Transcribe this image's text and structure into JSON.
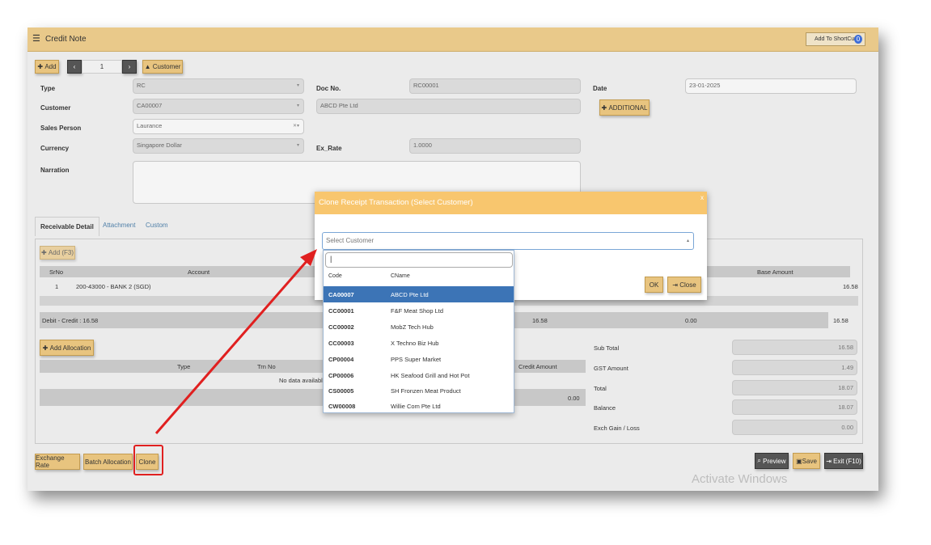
{
  "window": {
    "title": "Credit Note",
    "shortcut": "Add To ShortCut",
    "shortcut_badge": "0"
  },
  "toolbar": {
    "add": "Add",
    "record": "1",
    "customer": "Customer"
  },
  "form": {
    "type_label": "Type",
    "type_value": "RC",
    "docno_label": "Doc No.",
    "docno_value": "RC00001",
    "date_label": "Date",
    "date_value": "23-01-2025",
    "customer_label": "Customer",
    "customer_value": "CA00007",
    "customer_name": "ABCD Pte Ltd",
    "additional": "ADDITIONAL",
    "salesperson_label": "Sales Person",
    "salesperson_value": "Laurance",
    "currency_label": "Currency",
    "currency_value": "Singapore Dollar",
    "exrate_label": "Ex_Rate",
    "exrate_value": "1.0000",
    "narration_label": "Narration"
  },
  "tabs": [
    "Receivable Detail",
    "Attachment",
    "Custom"
  ],
  "detail": {
    "add": "Add (F3)",
    "headers": [
      "SrNo",
      "Account",
      "Base Amount"
    ],
    "row": {
      "srno": "1",
      "account": "200-43000 - BANK 2 (SGD)",
      "base": "16.58"
    },
    "footer_label": "Debit - Credit : 16.58",
    "footer_vals": [
      "16.58",
      "0.00",
      "16.58"
    ]
  },
  "allocation": {
    "add": "Add Allocation",
    "headers": [
      "Type",
      "Trn No",
      "Credit Amount"
    ],
    "empty": "No data available",
    "total": "0.00"
  },
  "summary": [
    {
      "label": "Sub Total",
      "value": "16.58"
    },
    {
      "label": "GST Amount",
      "value": "1.49"
    },
    {
      "label": "Total",
      "value": "18.07"
    },
    {
      "label": "Balance",
      "value": "18.07"
    },
    {
      "label": "Exch Gain / Loss",
      "value": "0.00"
    }
  ],
  "bottom": {
    "exchange": "Exchange Rate",
    "batch": "Batch Allocation",
    "clone": "Clone",
    "preview": "Preview",
    "save": "Save",
    "exit": "Exit (F10)"
  },
  "modal": {
    "title": "Clone Receipt Transaction (Select Customer)",
    "close": "x",
    "placeholder": "Select Customer",
    "ok": "OK",
    "cancel": "Close"
  },
  "dropdown": {
    "headers": {
      "code": "Code",
      "name": "CName"
    },
    "items": [
      {
        "code": "CA00007",
        "name": "ABCD Pte Ltd"
      },
      {
        "code": "CC00001",
        "name": "F&F Meat Shop Ltd"
      },
      {
        "code": "CC00002",
        "name": "MobZ Tech Hub"
      },
      {
        "code": "CC00003",
        "name": "X Techno Biz Hub"
      },
      {
        "code": "CP00004",
        "name": "PPS Super Market"
      },
      {
        "code": "CP00006",
        "name": "HK Seafood Grill and Hot Pot"
      },
      {
        "code": "CS00005",
        "name": "SH Fronzen Meat Product"
      },
      {
        "code": "CW00008",
        "name": "Willie Com Pte Ltd"
      }
    ]
  },
  "watermark": "Activate Windows",
  "colors": {
    "accent": "#e8c47f",
    "header": "#f8c66e",
    "selected": "#3c74b6",
    "annotation": "#e02020"
  }
}
